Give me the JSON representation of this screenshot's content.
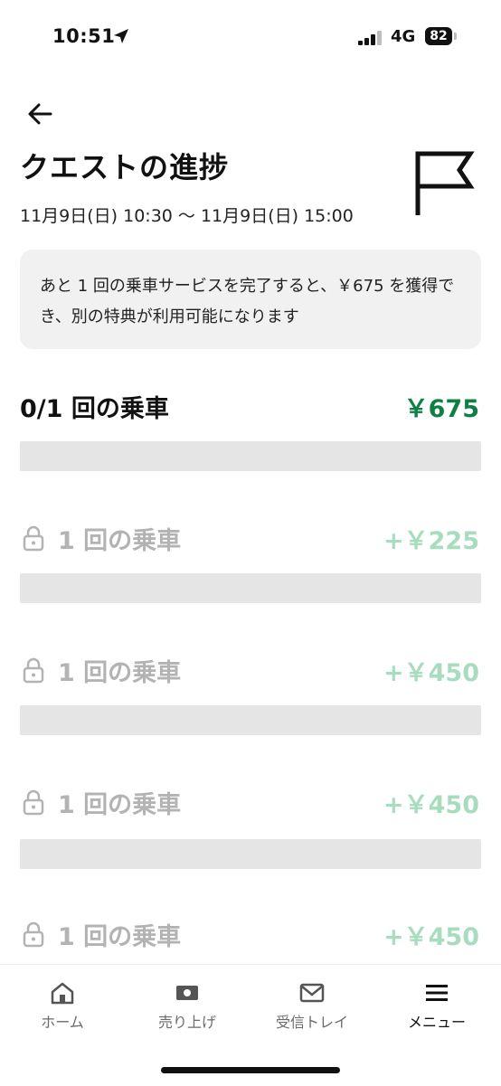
{
  "status": {
    "time": "10:51",
    "network": "4G",
    "battery": "82"
  },
  "header": {
    "title": "クエストの進捗",
    "date_range": "11月9日(日) 10:30 〜 11月9日(日) 15:00"
  },
  "info": {
    "message": "あと 1 回の乗車サービスを完了すると、￥675 を獲得でき、別の特典が利用可能になります"
  },
  "progress": {
    "label": "0/1 回の乗車",
    "amount": "￥675",
    "fraction": 0
  },
  "tiers": [
    {
      "label": "1 回の乗車",
      "amount": "+￥225",
      "fraction": 0
    },
    {
      "label": "1 回の乗車",
      "amount": "+￥450",
      "fraction": 0
    },
    {
      "label": "1 回の乗車",
      "amount": "+￥450",
      "fraction": 0
    },
    {
      "label": "1 回の乗車",
      "amount": "+￥450",
      "fraction": 0
    }
  ],
  "nav": [
    {
      "label": "ホーム",
      "icon": "home-icon"
    },
    {
      "label": "売り上げ",
      "icon": "earnings-icon"
    },
    {
      "label": "受信トレイ",
      "icon": "inbox-icon"
    },
    {
      "label": "メニュー",
      "icon": "menu-icon"
    }
  ],
  "colors": {
    "accent": "#0e7f45",
    "locked_amount": "#a8dcbf",
    "locked_text": "#b3b3b3",
    "bar": "#e5e5e5"
  }
}
